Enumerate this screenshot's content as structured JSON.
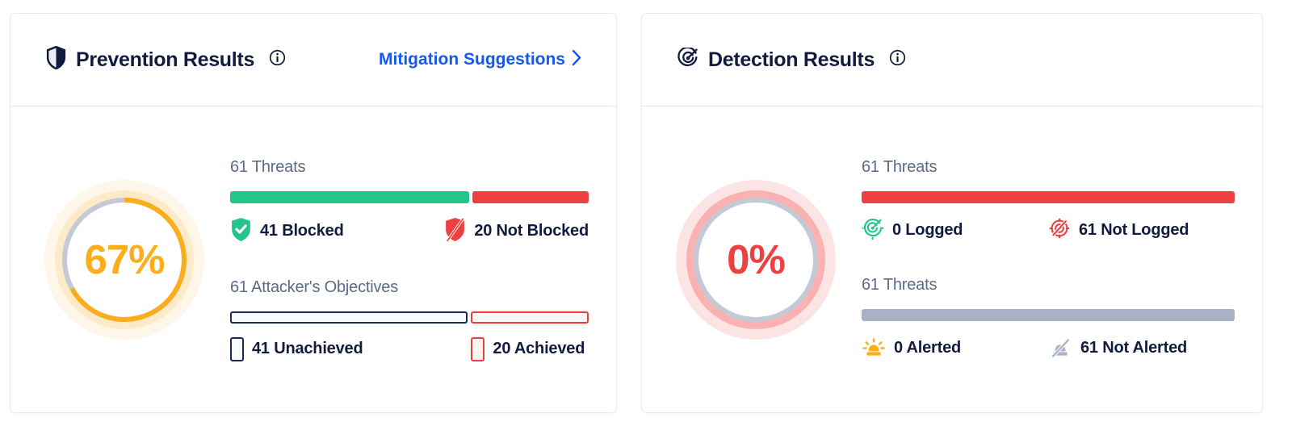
{
  "colors": {
    "navy": "#111b3d",
    "green": "#23c58a",
    "red": "#ee4040",
    "orange": "#fbad1b",
    "grey": "#a8b2c4",
    "link_blue": "#1558f0"
  },
  "prevention": {
    "title": "Prevention Results",
    "icon": "shield-icon",
    "info_icon": "info-icon",
    "link_label": "Mitigation Suggestions",
    "link_chevron": "chevron-right-icon",
    "gauge": {
      "value_label": "67%",
      "percent": 67,
      "color": "#fbad1b"
    },
    "metrics": [
      {
        "title": "61 Threats",
        "total": 61,
        "segments": [
          {
            "label": "41 Blocked",
            "value": 41,
            "style": "solid",
            "color": "#23c58a",
            "icon": "shield-check-icon"
          },
          {
            "label": "20 Not Blocked",
            "value": 20,
            "style": "solid",
            "color": "#ee4040",
            "icon": "shield-slash-icon"
          }
        ]
      },
      {
        "title": "61 Attacker's Objectives",
        "total": 61,
        "segments": [
          {
            "label": "41 Unachieved",
            "value": 41,
            "style": "outline",
            "color": "#1b2a52",
            "icon": "box-outline-navy-icon"
          },
          {
            "label": "20 Achieved",
            "value": 20,
            "style": "outline",
            "color": "#ee3b3b",
            "icon": "box-outline-red-icon"
          }
        ]
      }
    ]
  },
  "detection": {
    "title": "Detection Results",
    "icon": "target-icon",
    "info_icon": "info-icon",
    "gauge": {
      "value_label": "0%",
      "percent": 0,
      "color": "#ee4040"
    },
    "metrics": [
      {
        "title": "61 Threats",
        "total": 61,
        "segments": [
          {
            "label": "0 Logged",
            "value": 0,
            "style": "solid",
            "color": "#23c58a",
            "icon": "target-check-icon"
          },
          {
            "label": "61 Not Logged",
            "value": 61,
            "style": "solid",
            "color": "#ee4040",
            "icon": "target-slash-icon"
          }
        ]
      },
      {
        "title": "61 Threats",
        "total": 61,
        "segments": [
          {
            "label": "0 Alerted",
            "value": 0,
            "style": "solid",
            "color": "#fbad1b",
            "icon": "siren-icon"
          },
          {
            "label": "61 Not Alerted",
            "value": 61,
            "style": "solid",
            "color": "#a8b2c4",
            "icon": "siren-slash-icon"
          }
        ]
      }
    ]
  }
}
